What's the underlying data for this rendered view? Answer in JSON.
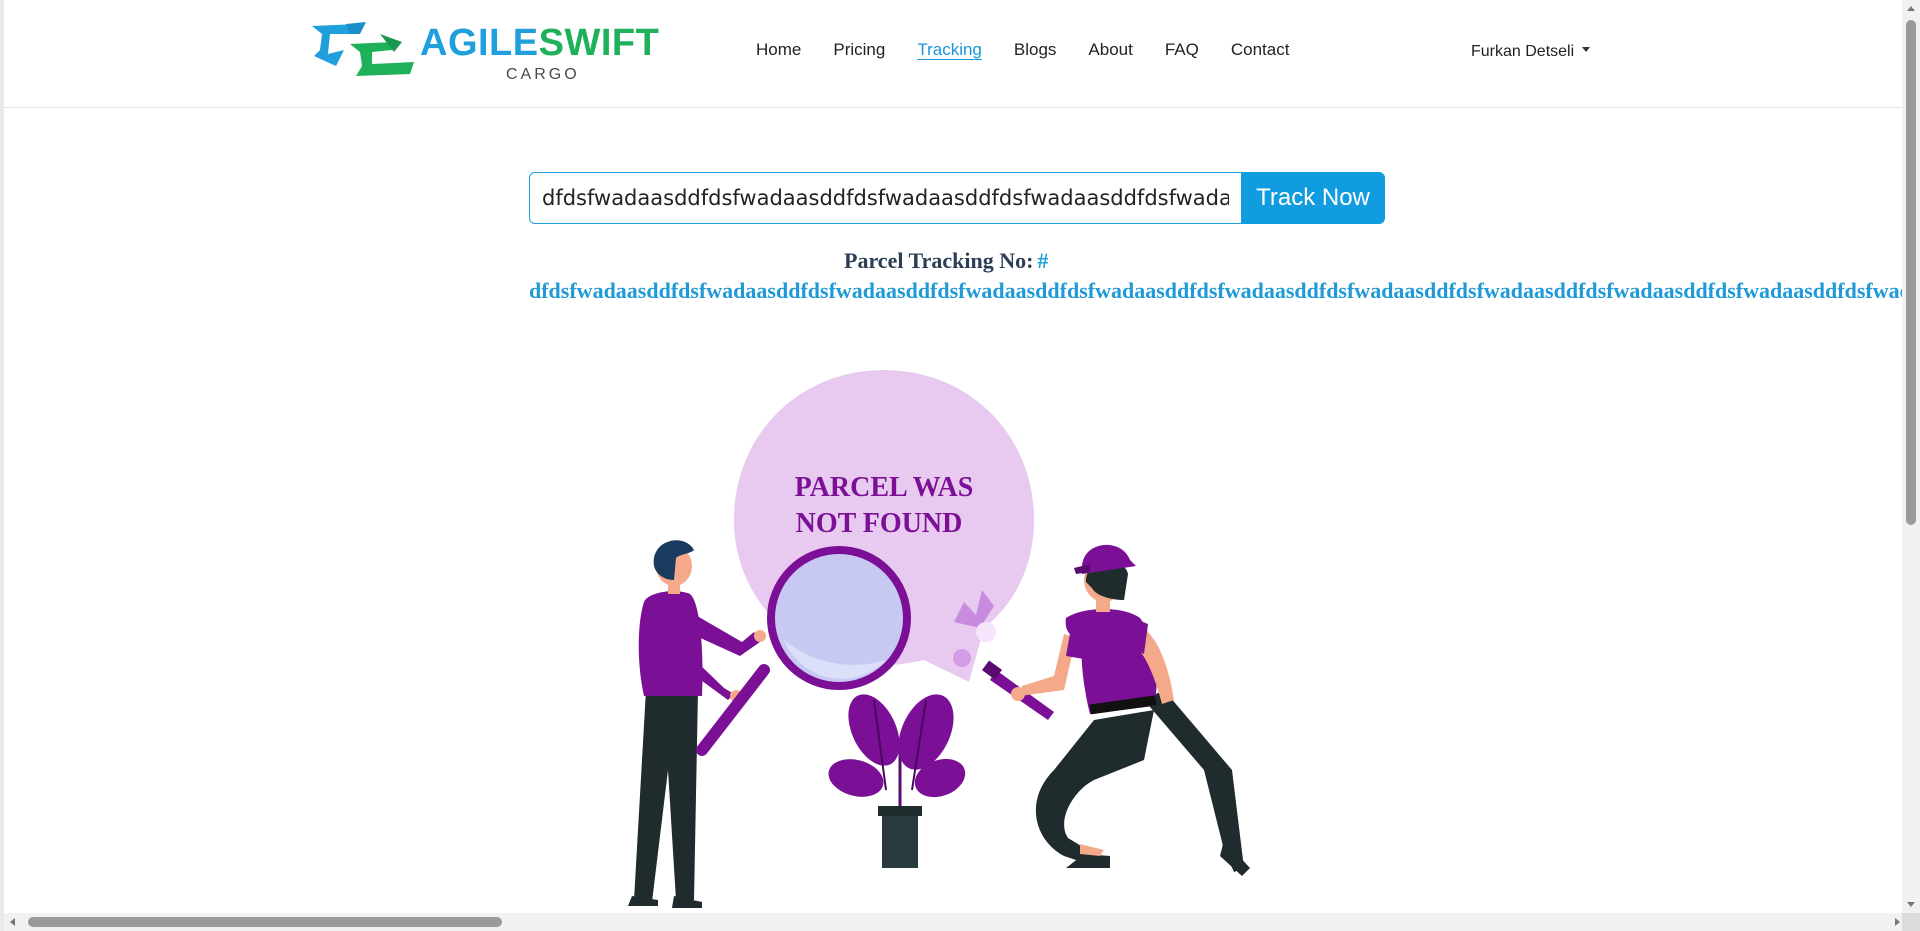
{
  "brand": {
    "name_part1": "AGILE",
    "name_part2": "SWIFT",
    "sub": "CARGO",
    "colors": {
      "blue": "#1fa0dc",
      "green": "#1eb15a"
    }
  },
  "nav": {
    "items": [
      {
        "label": "Home",
        "active": false
      },
      {
        "label": "Pricing",
        "active": false
      },
      {
        "label": "Tracking",
        "active": true
      },
      {
        "label": "Blogs",
        "active": false
      },
      {
        "label": "About",
        "active": false
      },
      {
        "label": "FAQ",
        "active": false
      },
      {
        "label": "Contact",
        "active": false
      }
    ],
    "user_name": "Furkan Detseli"
  },
  "search": {
    "value": "dfdsfwadaasddfdsfwadaasddfdsfwadaasddfdsfwadaasddfdsfwadaasddfdsfwadaasddfdsfwadaasddfdsfwadaasddfdsfwadaasddfdsfwadaasddfdsfwadaasdd",
    "button_label": "Track Now"
  },
  "tracking": {
    "label": "Parcel Tracking No:",
    "hash": "#",
    "value": "dfdsfwadaasddfdsfwadaasddfdsfwadaasddfdsfwadaasddfdsfwadaasddfdsfwadaasddfdsfwadaasddfdsfwadaasddfdsfwadaasddfdsfwadaasddfdsfwadaasdd"
  },
  "illustration": {
    "message_line1": "PARCEL WAS",
    "message_line2": "NOT FOUND",
    "colors": {
      "purple": "#7b0f96",
      "bubble": "#e8c9f0",
      "dark": "#1f2b2d",
      "skin": "#f3a98a"
    }
  }
}
